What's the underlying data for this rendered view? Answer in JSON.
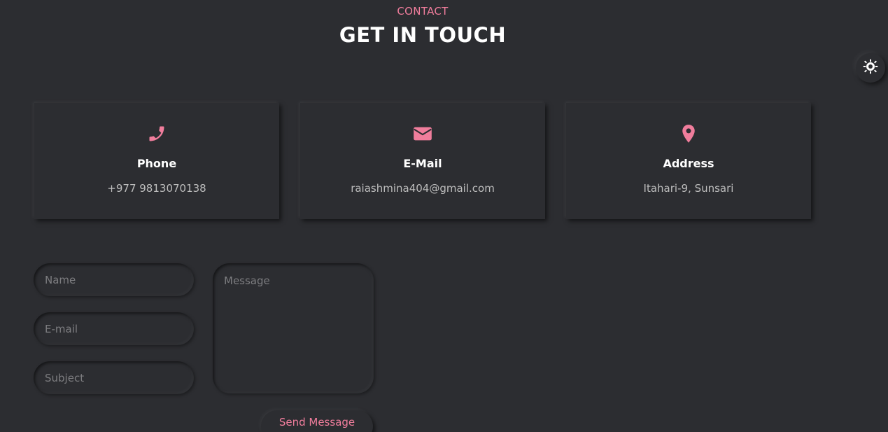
{
  "header": {
    "section_label": "CONTACT",
    "title": "GET IN TOUCH"
  },
  "theme_toggle": {
    "icon": "sun-icon"
  },
  "contact_cards": [
    {
      "icon": "phone-icon",
      "title": "Phone",
      "value": "+977 9813070138"
    },
    {
      "icon": "envelope-icon",
      "title": "E-Mail",
      "value": "raiashmina404@gmail.com"
    },
    {
      "icon": "map-pin-icon",
      "title": "Address",
      "value": "Itahari-9, Sunsari"
    }
  ],
  "form": {
    "name_placeholder": "Name",
    "email_placeholder": "E-mail",
    "subject_placeholder": "Subject",
    "message_placeholder": "Message",
    "submit_label": "Send Message"
  },
  "colors": {
    "background": "#2c2d31",
    "accent": "#f07d9c",
    "heading": "#ffffff",
    "muted_text": "#bdbdbd"
  }
}
